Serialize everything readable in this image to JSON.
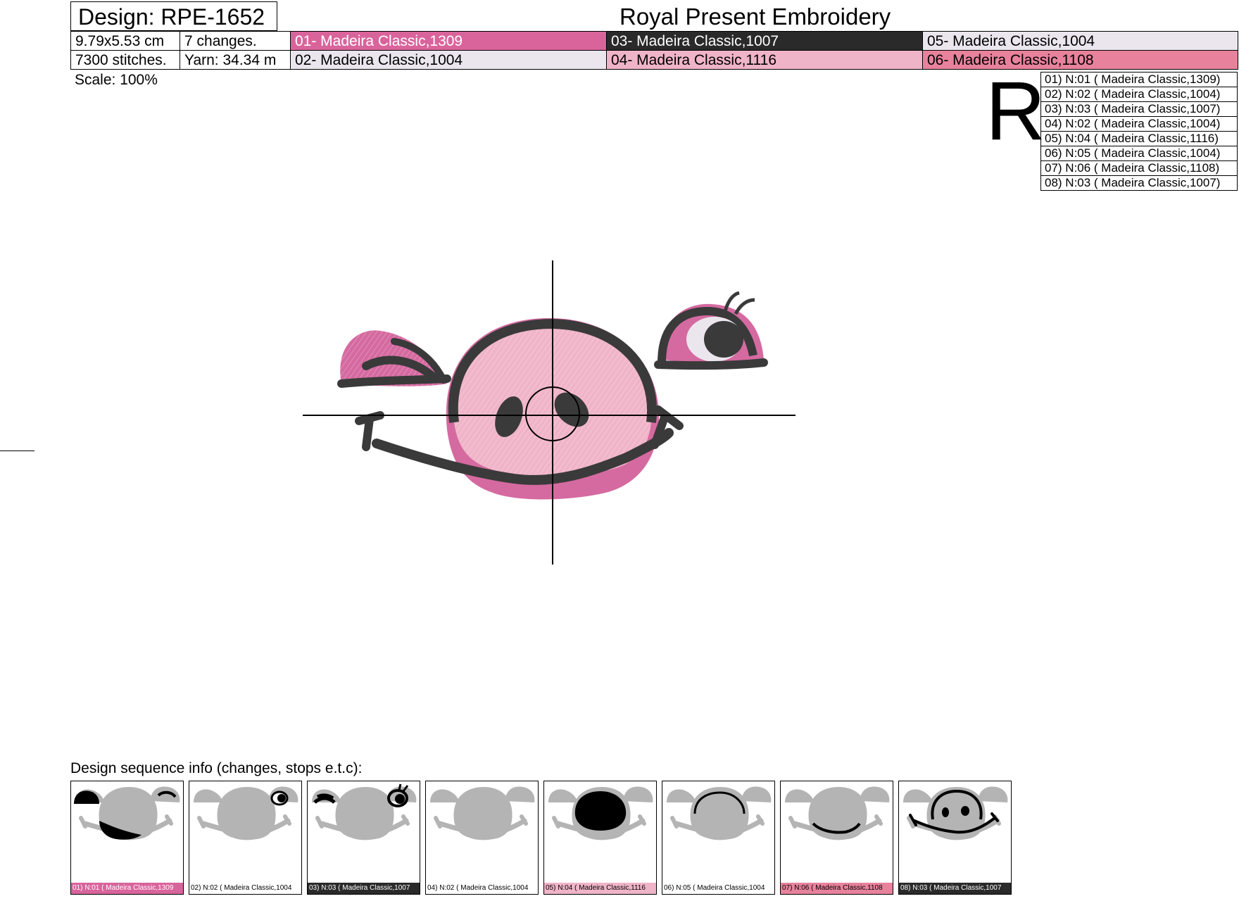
{
  "header": {
    "design_title": "Design: RPE-1652",
    "company": "Royal Present Embroidery",
    "size": "9.79x5.53 cm",
    "changes": "7 changes.",
    "stitches": "7300 stitches.",
    "yarn": "Yarn: 34.34 m",
    "scale": "Scale: 100%",
    "big_letter": "R"
  },
  "colors": [
    {
      "label": "01- Madeira Classic,1309",
      "bg": "#d9649c",
      "fg": "#ffffff"
    },
    {
      "label": "02- Madeira Classic,1004",
      "bg": "#ebe6ee",
      "fg": "#000000"
    },
    {
      "label": "03- Madeira Classic,1007",
      "bg": "#2a2a2a",
      "fg": "#ffffff"
    },
    {
      "label": "04- Madeira Classic,1116",
      "bg": "#f0b4c8",
      "fg": "#000000"
    },
    {
      "label": "05- Madeira Classic,1004",
      "bg": "#ebe6ee",
      "fg": "#000000"
    },
    {
      "label": "06- Madeira Classic,1108",
      "bg": "#e8829c",
      "fg": "#000000"
    }
  ],
  "sequence": [
    "01) N:01 ( Madeira Classic,1309)",
    "02) N:02 ( Madeira Classic,1004)",
    "03) N:03 ( Madeira Classic,1007)",
    "04) N:02 ( Madeira Classic,1004)",
    "05) N:04 ( Madeira Classic,1116)",
    "06) N:05 ( Madeira Classic,1004)",
    "07) N:06 ( Madeira Classic,1108)",
    "08) N:03 ( Madeira Classic,1007)"
  ],
  "sequence_info": {
    "title": "Design sequence info (changes, stops e.t.c):",
    "thumbnails": [
      {
        "label": "01) N:01 ( Madeira Classic,1309",
        "bg": "#d9649c",
        "fg": "#ffffff",
        "part": "ears-mouth"
      },
      {
        "label": "02) N:02 ( Madeira Classic,1004",
        "bg": "#ffffff",
        "fg": "#000000",
        "part": "eye-white"
      },
      {
        "label": "03) N:03 ( Madeira Classic,1007",
        "bg": "#2a2a2a",
        "fg": "#ffffff",
        "part": "eye-lines"
      },
      {
        "label": "04) N:02 ( Madeira Classic,1004",
        "bg": "#ffffff",
        "fg": "#000000",
        "part": "none"
      },
      {
        "label": "05) N:04 ( Madeira Classic,1116",
        "bg": "#f0b4c8",
        "fg": "#000000",
        "part": "snout"
      },
      {
        "label": "06) N:05 ( Madeira Classic,1004",
        "bg": "#ffffff",
        "fg": "#000000",
        "part": "highlight"
      },
      {
        "label": "07) N:06 ( Madeira Classic,1108",
        "bg": "#e8829c",
        "fg": "#000000",
        "part": "lip"
      },
      {
        "label": "08) N:03 ( Madeira Classic,1007",
        "bg": "#2a2a2a",
        "fg": "#ffffff",
        "part": "outline"
      }
    ]
  }
}
